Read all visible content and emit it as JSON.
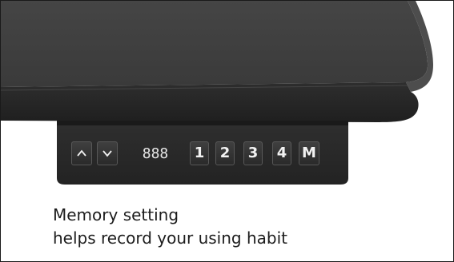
{
  "panel": {
    "up_icon": "chevron-up-icon",
    "down_icon": "chevron-down-icon",
    "display_value": "888",
    "preset_keys": [
      "1",
      "2",
      "3",
      "4"
    ],
    "memory_key": "M"
  },
  "caption": {
    "line1": "Memory setting",
    "line2": "helps record your using habit"
  },
  "colors": {
    "desktop": "#3c3c3c",
    "panel": "#272727",
    "key_text": "#f2f2f2",
    "caption_text": "#1c1c1c"
  }
}
